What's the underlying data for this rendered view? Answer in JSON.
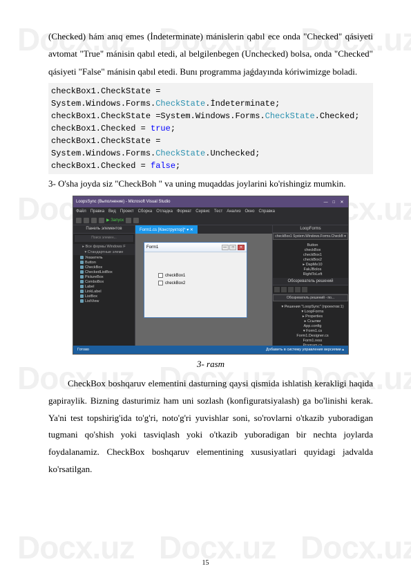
{
  "watermark": "Docx.uz",
  "para1": "(Checked)  hám  anıq emes (İndeterminate)  mánislerin qabıl ece onda \"Checked\" qásiyeti avtomat \"True\" mánisin qabıl etedi, al belgilenbegen (Unchecked) bolsa, onda \"Checked\" qásiyeti \"False\" mánisin qabıl etedi. Bunı programma jaǵdayında kóriwimizge boladi.",
  "code": {
    "l1a": "checkBox1.CheckState = System.Windows.Forms.",
    "l1b": "CheckState",
    "l1c": ".İndeterminate;",
    "l2a": "checkBox1.CheckState =System.Windows.Forms.",
    "l2b": "CheckState",
    "l2c": ".Checked;",
    "l3a": "checkBox1.Checked = ",
    "l3b": "true",
    "l3c": ";",
    "l4a": "checkBox1.CheckState = System.Windows.Forms.",
    "l4b": "CheckState",
    "l4c": ".Unchecked;",
    "l5a": "checkBox1.Checked = ",
    "l5b": "false",
    "l5c": ";"
  },
  "para2": "3- O'sha joyda siz  \"CheckBoh \" va uning muqaddas joylarini ko'rishingiz mumkin.",
  "ide": {
    "title": "LoopsSync (Выполнение) - Microsoft Visual Studio",
    "menus": [
      "Файл",
      "Правка",
      "Вид",
      "Проект",
      "Сборка",
      "Отладка",
      "Формат",
      "Сервис",
      "Тест",
      "Анализ",
      "Окно",
      "Справка"
    ],
    "start": "▶ Запуск",
    "leftTab": "Панель элементов",
    "search": "Поиск элемен...",
    "groups": [
      "▸ Все формы Windows F",
      "▾ Стандартные элеме"
    ],
    "items": [
      "Указатель",
      "Button",
      "CheckBox",
      "CheckedListBox",
      "PictureBox",
      "ComboBox",
      "Label",
      "LinkLabel",
      "ListBox",
      "ListView"
    ],
    "centerTab": "Form1.cs [Конструктор]* ▾ ✕",
    "form": {
      "title": "Form1",
      "cb1": "checkBox1",
      "cb2": "checkBox2"
    },
    "rightTop": {
      "head": "LoopForms",
      "combo": "checkBox1 System.Windows.Forms.CheckB ▾",
      "nodes": [
        "Button",
        "checkBox",
        "checkBox1",
        "checkBox2",
        "▸ DapMe10",
        "FakJBolos",
        "RightToLeft"
      ]
    },
    "rightMid": {
      "head": "Обозреватель решений",
      "search": "Обозреватель решений - по...",
      "nodes": [
        "▾ Решения \"LoopSync\" (проектов:1)",
        "  ▾ LoopForms",
        "    ▸ Properties",
        "    ▸ Ссылки",
        "    App.config",
        "    ▾ Form1.cs",
        "      Form1.Designer.cs",
        "      Form1.resx",
        "    Program.cs"
      ]
    },
    "status": {
      "left": "Готово",
      "right": "Добавить в систему управления версиями ▴"
    }
  },
  "caption": "3- rasm",
  "para3": "CheckBox boshqaruv elementini dasturning qaysi qismida ishlatish kerakligi haqida gapiraylik. Bizning dasturimiz ham uni sozlash (konfiguratsiyalash) ga bo'linishi kerak. Ya'ni test topshirig'ida to'g'ri, noto'g'ri yuvishlar soni, so'rovlarni o'tkazib yuboradigan tugmani qo'shish yoki tasviqlash yoki o'tkazib yuboradigan bir nechta joylarda foydalanamiz. CheckBox boshqaruv elementining xususiyatlari quyidagi jadvalda ko'rsatilgan.",
  "pagenum": "15"
}
